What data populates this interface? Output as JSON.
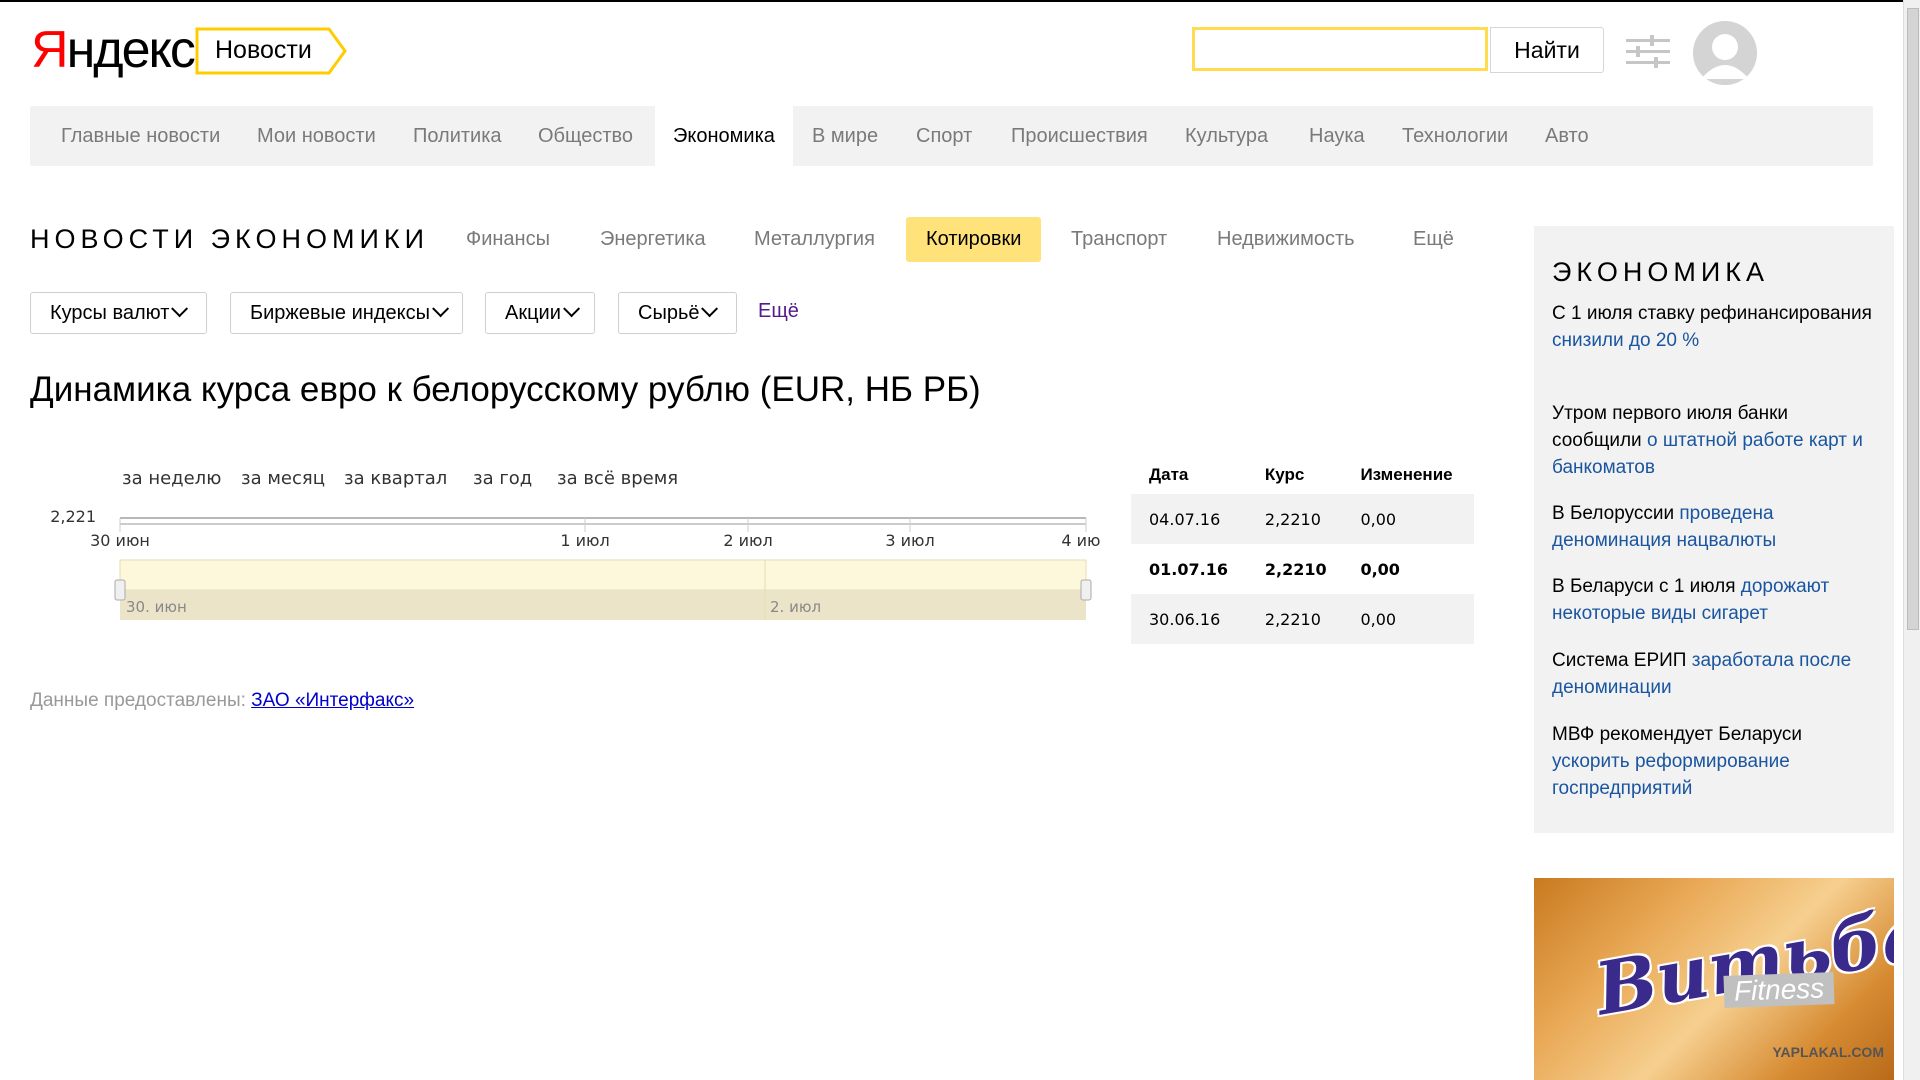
{
  "header": {
    "logo_first": "Я",
    "logo_rest": "ндекс",
    "service_tag": "Новости",
    "search_value": "",
    "search_button": "Найти",
    "settings_icon": "sliders-icon",
    "avatar_icon": "user-avatar-icon"
  },
  "topnav": {
    "items": [
      {
        "label": "Главные новости"
      },
      {
        "label": "Мои новости"
      },
      {
        "label": "Политика"
      },
      {
        "label": "Общество"
      },
      {
        "label": "Экономика",
        "active": true
      },
      {
        "label": "В мире"
      },
      {
        "label": "Спорт"
      },
      {
        "label": "Происшествия"
      },
      {
        "label": "Культура"
      },
      {
        "label": "Наука"
      },
      {
        "label": "Технологии"
      },
      {
        "label": "Авто"
      }
    ]
  },
  "section": {
    "title": "НОВОСТИ ЭКОНОМИКИ",
    "subnav": [
      {
        "label": "Финансы"
      },
      {
        "label": "Энергетика"
      },
      {
        "label": "Металлургия"
      },
      {
        "label": "Котировки",
        "active": true
      },
      {
        "label": "Транспорт"
      },
      {
        "label": "Недвижимость"
      },
      {
        "label": "Ещё"
      }
    ]
  },
  "filters": {
    "dropdowns": [
      {
        "label": "Курсы валют"
      },
      {
        "label": "Биржевые индексы"
      },
      {
        "label": "Акции"
      },
      {
        "label": "Сырьё"
      }
    ],
    "more": "Ещё"
  },
  "page_heading": "Динамика курса евро к белорусскому рублю (EUR, НБ РБ)",
  "periods": [
    "за неделю",
    "за месяц",
    "за квартал",
    "за год",
    "за всё время"
  ],
  "chart_data": {
    "type": "line",
    "y_tick": "2,221",
    "x_ticks": [
      "30 июн",
      "1 июл",
      "2 июл",
      "3 июл",
      "4 июл"
    ],
    "navigator_labels": [
      "30. июн",
      "2. июл"
    ],
    "series": [
      {
        "x": [
          "30 июн",
          "1 июл",
          "2 июл",
          "3 июл",
          "4 июл"
        ],
        "values": [
          2.221,
          2.221,
          2.221,
          2.221,
          2.221
        ]
      }
    ]
  },
  "rate_table": {
    "headers": [
      "Дата",
      "Курс",
      "Изменение"
    ],
    "rows": [
      {
        "date": "04.07.16",
        "rate": "2,2210",
        "change": "0,00",
        "shaded": true,
        "bold": false
      },
      {
        "date": "01.07.16",
        "rate": "2,2210",
        "change": "0,00",
        "shaded": false,
        "bold": true
      },
      {
        "date": "30.06.16",
        "rate": "2,2210",
        "change": "0,00",
        "shaded": true,
        "bold": false
      }
    ]
  },
  "source": {
    "prefix": "Данные предоставлены:",
    "link": "ЗАО «Интерфакс»"
  },
  "sidebar": {
    "title": "ЭКОНОМИКА",
    "news": [
      {
        "text": "С 1 июля ставку рефинансирования",
        "link": "снизили до 20 %"
      },
      {
        "text": "Утром первого июля банки сообщили",
        "link": "о штатной работе карт и банкоматов"
      },
      {
        "text": "В Белоруссии",
        "link": "проведена деноминация нацвалюты"
      },
      {
        "text": "В Беларуси с 1 июля",
        "link": "дорожают некоторые виды сигарет"
      },
      {
        "text": "Система ЕРИП",
        "link": "заработала после деноминации"
      },
      {
        "text": "МВФ рекомендует Беларуси",
        "link": "ускорить реформирование госпредприятий"
      }
    ]
  },
  "ad": {
    "brand": "Витьба",
    "sub": "Fitness",
    "watermark": "YAPLAKAL.COM"
  },
  "colors": {
    "accent_yellow": "#ffdb4d",
    "active_subnav": "#ffe27a",
    "link_blue": "#1a55a0",
    "logo_red": "#ff0000"
  }
}
